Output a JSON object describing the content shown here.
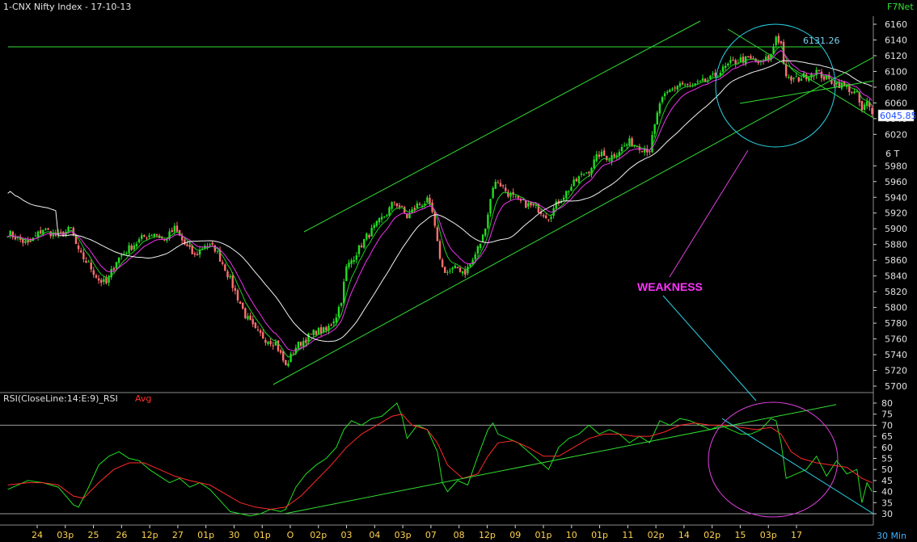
{
  "header": {
    "title": "1-CNX Nifty Index - 17-10-13",
    "brand": "F7Net"
  },
  "colors": {
    "background": "#000000",
    "up_candle": "#22dd22",
    "down_candle": "#ff7070",
    "ema_short": "#22cc22",
    "ema_mid": "#ee33ee",
    "sma_long": "#f2f2f2",
    "trendline": "#33dd33",
    "circle": "#2ad4e6",
    "circle_rsi": "#e040e0",
    "weakness_text": "#ff33ff",
    "rsi_line": "#22dd22",
    "rsi_avg": "#ff2a2a",
    "axis_text": "#e0e0e0",
    "date_text": "#ffd24d",
    "timeframe_text": "#3fb0ff",
    "price_box": "#ffffff",
    "price_box_text": "#1a4cff"
  },
  "price_panel": {
    "resistance_label": "6131.26",
    "current_price": "6045.85",
    "axis_marker": "6 T",
    "annotation": "WEAKNESS"
  },
  "rsi_panel": {
    "title": "RSI(CloseLine:14:E:9)_RSI",
    "avg_label": "Avg"
  },
  "timeframe": "30 Min",
  "chart_data": [
    {
      "type": "candlestick",
      "title": "1-CNX Nifty Index - 17-10-13",
      "ylim": [
        5700,
        6160
      ],
      "y_ticks": [
        6160,
        6140,
        6120,
        6100,
        6080,
        6060,
        6040,
        6020,
        5980,
        5960,
        5940,
        5920,
        5900,
        5880,
        5860,
        5840,
        5820,
        5800,
        5780,
        5760,
        5740,
        5720,
        5700
      ],
      "x_ticks": [
        "24",
        "03p",
        "25",
        "26",
        "12p",
        "27",
        "01p",
        "30",
        "01p",
        "O",
        "02p",
        "03",
        "04",
        "03p",
        "07",
        "08",
        "12p",
        "09",
        "01p",
        "10",
        "01p",
        "11",
        "02p",
        "14",
        "02p",
        "15",
        "03p",
        "17"
      ],
      "close_path": [
        [
          0,
          5895
        ],
        [
          8,
          5880
        ],
        [
          14,
          5900
        ],
        [
          20,
          5890
        ],
        [
          25,
          5900
        ],
        [
          28,
          5870
        ],
        [
          32,
          5855
        ],
        [
          36,
          5835
        ],
        [
          39,
          5830
        ],
        [
          43,
          5860
        ],
        [
          48,
          5875
        ],
        [
          54,
          5890
        ],
        [
          58,
          5895
        ],
        [
          62,
          5885
        ],
        [
          66,
          5900
        ],
        [
          70,
          5880
        ],
        [
          74,
          5865
        ],
        [
          78,
          5880
        ],
        [
          82,
          5875
        ],
        [
          86,
          5850
        ],
        [
          90,
          5820
        ],
        [
          94,
          5790
        ],
        [
          98,
          5770
        ],
        [
          102,
          5760
        ],
        [
          106,
          5755
        ],
        [
          108,
          5740
        ],
        [
          110,
          5725
        ],
        [
          114,
          5750
        ],
        [
          118,
          5760
        ],
        [
          122,
          5770
        ],
        [
          126,
          5770
        ],
        [
          130,
          5790
        ],
        [
          132,
          5810
        ],
        [
          134,
          5850
        ],
        [
          138,
          5870
        ],
        [
          142,
          5890
        ],
        [
          146,
          5905
        ],
        [
          150,
          5920
        ],
        [
          153,
          5935
        ],
        [
          156,
          5925
        ],
        [
          158,
          5915
        ],
        [
          162,
          5930
        ],
        [
          166,
          5935
        ],
        [
          168,
          5920
        ],
        [
          170,
          5880
        ],
        [
          172,
          5850
        ],
        [
          174,
          5845
        ],
        [
          178,
          5850
        ],
        [
          181,
          5845
        ],
        [
          184,
          5860
        ],
        [
          188,
          5890
        ],
        [
          190,
          5920
        ],
        [
          192,
          5955
        ],
        [
          194,
          5960
        ],
        [
          198,
          5945
        ],
        [
          202,
          5935
        ],
        [
          206,
          5930
        ],
        [
          210,
          5925
        ],
        [
          214,
          5915
        ],
        [
          218,
          5935
        ],
        [
          222,
          5950
        ],
        [
          226,
          5965
        ],
        [
          230,
          5975
        ],
        [
          234,
          5995
        ],
        [
          238,
          5990
        ],
        [
          242,
          6000
        ],
        [
          246,
          6010
        ],
        [
          250,
          6005
        ],
        [
          254,
          6000
        ],
        [
          256,
          6030
        ],
        [
          258,
          6060
        ],
        [
          262,
          6075
        ],
        [
          266,
          6085
        ],
        [
          270,
          6080
        ],
        [
          274,
          6085
        ],
        [
          278,
          6090
        ],
        [
          282,
          6100
        ],
        [
          286,
          6110
        ],
        [
          290,
          6115
        ],
        [
          294,
          6115
        ],
        [
          298,
          6110
        ],
        [
          302,
          6120
        ],
        [
          304,
          6145
        ],
        [
          306,
          6135
        ],
        [
          308,
          6090
        ],
        [
          312,
          6090
        ],
        [
          316,
          6095
        ],
        [
          320,
          6100
        ],
        [
          324,
          6090
        ],
        [
          328,
          6085
        ],
        [
          332,
          6080
        ],
        [
          336,
          6070
        ],
        [
          338,
          6050
        ],
        [
          340,
          6060
        ],
        [
          342,
          6045
        ]
      ]
    },
    {
      "type": "line",
      "title": "RSI(CloseLine:14:E:9)_RSI",
      "series": [
        {
          "name": "RSI",
          "role": "rsi"
        },
        {
          "name": "Avg",
          "role": "avg"
        }
      ],
      "ylim": [
        30,
        80
      ],
      "y_ticks": [
        80,
        75,
        70,
        65,
        60,
        55,
        50,
        45,
        40,
        35,
        30
      ],
      "reference_lines": [
        70,
        30
      ],
      "rsi_path": [
        [
          0,
          41
        ],
        [
          8,
          45
        ],
        [
          14,
          44
        ],
        [
          20,
          42
        ],
        [
          26,
          34
        ],
        [
          28,
          33
        ],
        [
          32,
          42
        ],
        [
          36,
          52
        ],
        [
          40,
          56
        ],
        [
          44,
          58
        ],
        [
          48,
          55
        ],
        [
          52,
          54
        ],
        [
          56,
          50
        ],
        [
          60,
          47
        ],
        [
          64,
          44
        ],
        [
          68,
          46
        ],
        [
          72,
          42
        ],
        [
          76,
          44
        ],
        [
          80,
          41
        ],
        [
          84,
          36
        ],
        [
          88,
          31
        ],
        [
          92,
          30
        ],
        [
          96,
          29
        ],
        [
          100,
          30
        ],
        [
          104,
          32
        ],
        [
          108,
          31
        ],
        [
          110,
          32
        ],
        [
          114,
          42
        ],
        [
          118,
          48
        ],
        [
          122,
          52
        ],
        [
          126,
          55
        ],
        [
          130,
          60
        ],
        [
          133,
          68
        ],
        [
          136,
          72
        ],
        [
          140,
          70
        ],
        [
          144,
          73
        ],
        [
          148,
          74
        ],
        [
          152,
          78
        ],
        [
          154,
          80
        ],
        [
          156,
          74
        ],
        [
          158,
          64
        ],
        [
          162,
          70
        ],
        [
          166,
          68
        ],
        [
          170,
          58
        ],
        [
          172,
          44
        ],
        [
          174,
          40
        ],
        [
          178,
          45
        ],
        [
          182,
          43
        ],
        [
          186,
          56
        ],
        [
          190,
          68
        ],
        [
          192,
          71
        ],
        [
          194,
          66
        ],
        [
          198,
          64
        ],
        [
          202,
          62
        ],
        [
          206,
          58
        ],
        [
          210,
          54
        ],
        [
          214,
          50
        ],
        [
          218,
          60
        ],
        [
          222,
          64
        ],
        [
          226,
          66
        ],
        [
          230,
          70
        ],
        [
          234,
          66
        ],
        [
          238,
          68
        ],
        [
          242,
          66
        ],
        [
          246,
          62
        ],
        [
          250,
          65
        ],
        [
          254,
          62
        ],
        [
          258,
          72
        ],
        [
          262,
          70
        ],
        [
          266,
          73
        ],
        [
          270,
          72
        ],
        [
          274,
          70
        ],
        [
          278,
          68
        ],
        [
          282,
          70
        ],
        [
          286,
          68
        ],
        [
          290,
          66
        ],
        [
          294,
          66
        ],
        [
          298,
          68
        ],
        [
          302,
          73
        ],
        [
          304,
          72
        ],
        [
          306,
          62
        ],
        [
          308,
          46
        ],
        [
          312,
          48
        ],
        [
          316,
          50
        ],
        [
          320,
          56
        ],
        [
          324,
          47
        ],
        [
          328,
          54
        ],
        [
          332,
          48
        ],
        [
          336,
          50
        ],
        [
          338,
          35
        ],
        [
          340,
          44
        ],
        [
          342,
          40
        ]
      ],
      "avg_path": [
        [
          0,
          43
        ],
        [
          8,
          44
        ],
        [
          14,
          44
        ],
        [
          20,
          43
        ],
        [
          26,
          38
        ],
        [
          30,
          37
        ],
        [
          36,
          44
        ],
        [
          42,
          50
        ],
        [
          48,
          53
        ],
        [
          54,
          53
        ],
        [
          60,
          50
        ],
        [
          66,
          47
        ],
        [
          72,
          45
        ],
        [
          80,
          43
        ],
        [
          86,
          39
        ],
        [
          92,
          35
        ],
        [
          98,
          33
        ],
        [
          104,
          32
        ],
        [
          110,
          33
        ],
        [
          116,
          38
        ],
        [
          122,
          45
        ],
        [
          128,
          52
        ],
        [
          134,
          60
        ],
        [
          140,
          66
        ],
        [
          146,
          70
        ],
        [
          152,
          74
        ],
        [
          156,
          75
        ],
        [
          160,
          70
        ],
        [
          166,
          68
        ],
        [
          170,
          62
        ],
        [
          174,
          52
        ],
        [
          180,
          46
        ],
        [
          186,
          48
        ],
        [
          190,
          56
        ],
        [
          194,
          62
        ],
        [
          200,
          63
        ],
        [
          206,
          60
        ],
        [
          212,
          56
        ],
        [
          218,
          56
        ],
        [
          224,
          60
        ],
        [
          230,
          64
        ],
        [
          236,
          66
        ],
        [
          242,
          66
        ],
        [
          248,
          65
        ],
        [
          254,
          65
        ],
        [
          260,
          67
        ],
        [
          266,
          70
        ],
        [
          272,
          71
        ],
        [
          278,
          70
        ],
        [
          284,
          70
        ],
        [
          290,
          69
        ],
        [
          296,
          68
        ],
        [
          302,
          69
        ],
        [
          306,
          66
        ],
        [
          310,
          58
        ],
        [
          314,
          55
        ],
        [
          320,
          53
        ],
        [
          326,
          52
        ],
        [
          332,
          51
        ],
        [
          338,
          46
        ],
        [
          342,
          44
        ]
      ]
    }
  ]
}
